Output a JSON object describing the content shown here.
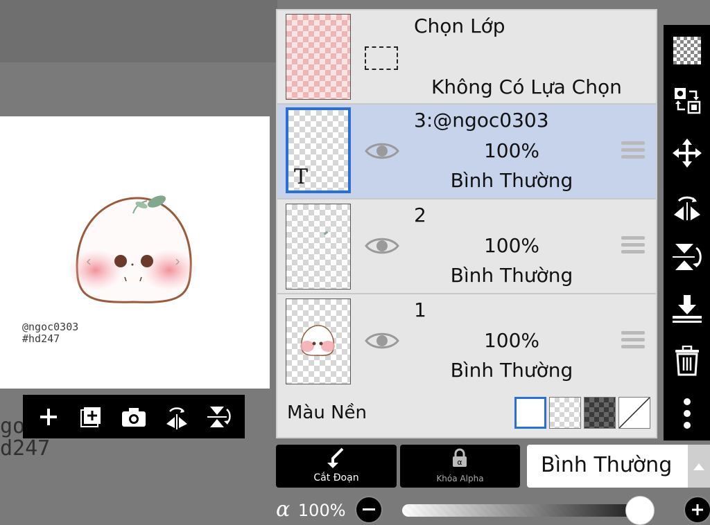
{
  "canvas": {
    "signature_line1": "@ngoc0303",
    "signature_line2": "#hd247",
    "ghost_line1": "goc",
    "ghost_line2": "d247"
  },
  "canvas_toolbar": {
    "icons": [
      "add-layer-icon",
      "duplicate-layer-icon",
      "camera-icon",
      "flip-horizontal-icon",
      "flip-vertical-icon"
    ]
  },
  "layer_panel": {
    "selection": {
      "title": "Chọn Lớp",
      "status": "Không Có Lựa Chọn"
    },
    "layers": [
      {
        "name": "3:@ngoc0303",
        "opacity": "100%",
        "mode": "Bình Thường",
        "selected": true,
        "thumb_text": "T"
      },
      {
        "name": "2",
        "opacity": "100%",
        "mode": "Bình Thường",
        "selected": false
      },
      {
        "name": "1",
        "opacity": "100%",
        "mode": "Bình Thường",
        "selected": false
      }
    ],
    "background": {
      "label": "Màu Nền",
      "swatches": [
        "white",
        "transparent",
        "dark-checker",
        "none"
      ]
    }
  },
  "right_toolbar": {
    "icons": [
      "transparency-icon",
      "swap-layer-icon",
      "move-icon",
      "flip-horizontal-icon",
      "flip-vertical-icon",
      "merge-down-icon",
      "trash-icon",
      "more-icon"
    ]
  },
  "bottom": {
    "clip_label": "Cắt Đoạn",
    "alpha_lock_label": "Khóa Alpha",
    "blend_mode": "Bình Thường",
    "alpha_symbol": "α",
    "alpha_value": "100%",
    "alpha_fraction": 1.0
  },
  "colors": {
    "accent_blue": "#2a6fd6",
    "selected_row": "#c6d3ea",
    "panel_bg": "#e6e6e6",
    "toolbar_bg": "#000000",
    "blush_pink": "#f4a8ae",
    "outline_brown": "#9b5a3c",
    "sprout_green": "#7fa88c"
  }
}
